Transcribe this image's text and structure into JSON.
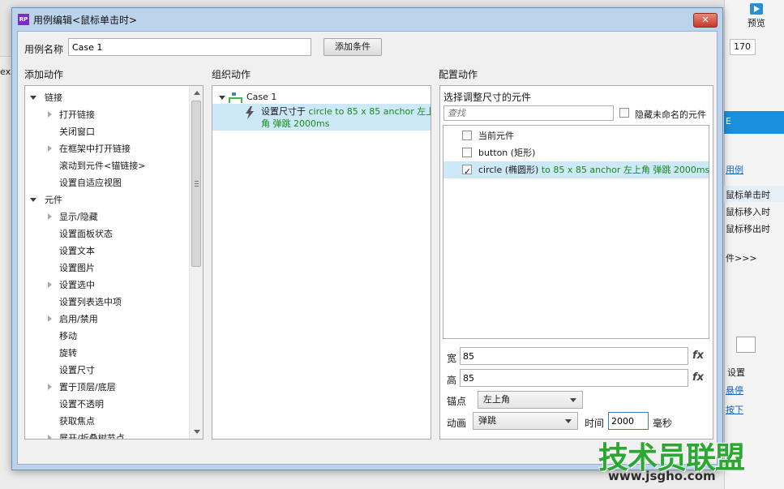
{
  "background_app": {
    "preview_label": "预览",
    "zoom_value": "170",
    "tab_label": "E",
    "left_partial": "ex",
    "right_items": [
      "用例",
      "鼠标单击时",
      "鼠标移入时",
      "鼠标移出时",
      "件>>>"
    ],
    "bottom_items": [
      "设置",
      "悬停",
      "按下"
    ]
  },
  "dialog": {
    "app_icon_text": "RP",
    "title": "用例编辑<鼠标单击时>",
    "close_label": "✕",
    "case_name_label": "用例名称",
    "case_name_value": "Case 1",
    "add_condition_label": "添加条件",
    "sections": {
      "add_action": "添加动作",
      "organize_action": "组织动作",
      "configure_action": "配置动作"
    }
  },
  "action_tree": [
    {
      "label": "链接",
      "level": 0,
      "expander": "down"
    },
    {
      "label": "打开链接",
      "level": 1,
      "expander": "right"
    },
    {
      "label": "关闭窗口",
      "level": 1,
      "expander": "none"
    },
    {
      "label": "在框架中打开链接",
      "level": 1,
      "expander": "right"
    },
    {
      "label": "滚动到元件<锚链接>",
      "level": 1,
      "expander": "none"
    },
    {
      "label": "设置自适应视图",
      "level": 1,
      "expander": "none"
    },
    {
      "label": "元件",
      "level": 0,
      "expander": "down"
    },
    {
      "label": "显示/隐藏",
      "level": 1,
      "expander": "right"
    },
    {
      "label": "设置面板状态",
      "level": 1,
      "expander": "none"
    },
    {
      "label": "设置文本",
      "level": 1,
      "expander": "none"
    },
    {
      "label": "设置图片",
      "level": 1,
      "expander": "none"
    },
    {
      "label": "设置选中",
      "level": 1,
      "expander": "right"
    },
    {
      "label": "设置列表选中项",
      "level": 1,
      "expander": "none"
    },
    {
      "label": "启用/禁用",
      "level": 1,
      "expander": "right"
    },
    {
      "label": "移动",
      "level": 1,
      "expander": "none"
    },
    {
      "label": "旋转",
      "level": 1,
      "expander": "none"
    },
    {
      "label": "设置尺寸",
      "level": 1,
      "expander": "none"
    },
    {
      "label": "置于顶层/底层",
      "level": 1,
      "expander": "right"
    },
    {
      "label": "设置不透明",
      "level": 1,
      "expander": "none"
    },
    {
      "label": "获取焦点",
      "level": 1,
      "expander": "none"
    },
    {
      "label": "展开/折叠树节点",
      "level": 1,
      "expander": "right"
    }
  ],
  "organize": {
    "case_label": "Case 1",
    "action_prefix": "设置尺寸于",
    "action_detail_line1": "circle to 85 x 85 anchor 左上",
    "action_detail_line2": "角 弹跳 2000ms"
  },
  "configure": {
    "title": "选择调整尺寸的元件",
    "find_placeholder": "查找",
    "hide_unnamed_label": "隐藏未命名的元件",
    "widgets": [
      {
        "name": "当前元件",
        "detail": "",
        "checked": false,
        "selected": false
      },
      {
        "name": "button (矩形)",
        "detail": "",
        "checked": false,
        "selected": false
      },
      {
        "name": "circle (椭圆形)",
        "detail": " to 85 x 85 anchor 左上角 弹跳 2000ms",
        "checked": true,
        "selected": true
      }
    ],
    "width_label": "宽",
    "width_value": "85",
    "height_label": "高",
    "height_value": "85",
    "fx_label": "fx",
    "anchor_label": "锚点",
    "anchor_value": "左上角",
    "animation_label": "动画",
    "animation_value": "弹跳",
    "time_label": "时间",
    "time_value": "2000",
    "time_unit": "毫秒"
  },
  "watermark": {
    "main": "技术员联盟",
    "url": "www.jsgho.com"
  },
  "colors": {
    "selection": "#cde8f7",
    "detail_green": "#168a16",
    "watermark_green": "#2aa832",
    "dialog_frame": "#bcd3ec"
  }
}
